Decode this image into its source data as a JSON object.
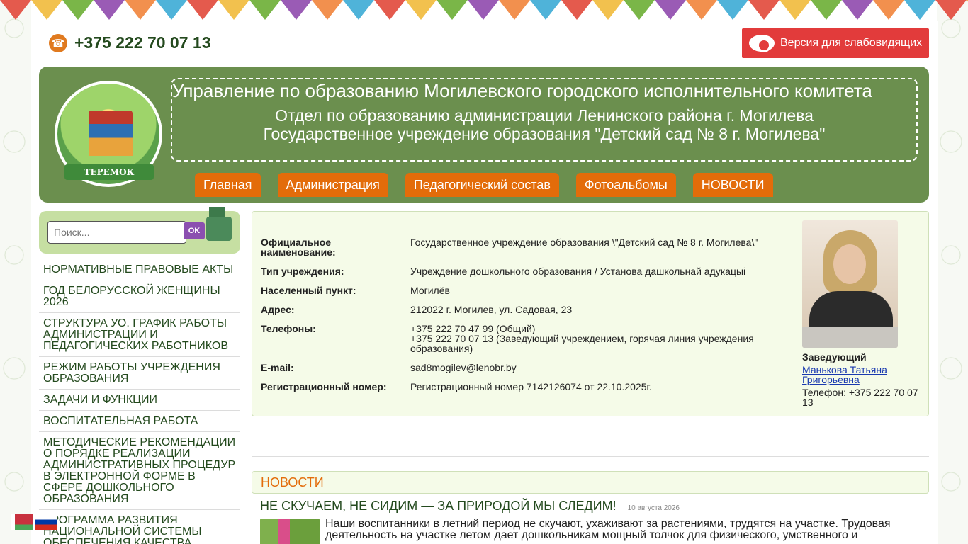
{
  "colors": {
    "header_green": "#6b8f4e",
    "nav_orange": "#e36c0a",
    "vision_red": "#e23b3b",
    "text_dark_green": "#244a1e",
    "panel_bg": "#f5fbe8"
  },
  "bunting_colors": [
    "#e45a4d",
    "#f2c14e",
    "#7ab648",
    "#9a5bb5",
    "#f2904e",
    "#4fb3d9"
  ],
  "top_bar": {
    "phone_icon": "phone-icon",
    "phone": "+375 222 70 07 13",
    "vision_icon": "eye-icon",
    "vision_label": "Версия для слабовидящих"
  },
  "header": {
    "logo_text": "ТЕРЕМОК",
    "title_main": "Управление по образованию Могилевского городского исполнительного комитета",
    "title_sub1": "Отдел по образованию администрации Ленинского района г. Могилева",
    "title_sub2": "Государственное учреждение образования \"Детский сад № 8 г. Могилева\""
  },
  "nav": [
    {
      "label": "Главная"
    },
    {
      "label": "Администрация"
    },
    {
      "label": "Педагогический состав"
    },
    {
      "label": "Фотоальбомы"
    },
    {
      "label": "НОВОСТИ"
    }
  ],
  "search": {
    "placeholder": "Поиск...",
    "button_label": "OK"
  },
  "sidebar": {
    "items": [
      {
        "label": "НОРМАТИВНЫЕ ПРАВОВЫЕ АКТЫ"
      },
      {
        "label": "ГОД БЕЛОРУССКОЙ ЖЕНЩИНЫ 2026"
      },
      {
        "label": "СТРУКТУРА УО. ГРАФИК РАБОТЫ АДМИНИСТРАЦИИ И ПЕДАГОГИЧЕСКИХ РАБОТНИКОВ"
      },
      {
        "label": "РЕЖИМ РАБОТЫ УЧРЕЖДЕНИЯ ОБРАЗОВАНИЯ"
      },
      {
        "label": "ЗАДАЧИ И ФУНКЦИИ"
      },
      {
        "label": "ВОСПИТАТЕЛЬНАЯ РАБОТА"
      },
      {
        "label": "МЕТОДИЧЕСКИЕ РЕКОМЕНДАЦИИ О ПОРЯДКЕ РЕАЛИЗАЦИИ АДМИНИСТРАТИВНЫХ ПРОЦЕДУР В ЭЛЕКТРОННОЙ ФОРМЕ В СФЕРЕ ДОШКОЛЬНОГО ОБРАЗОВАНИЯ"
      },
      {
        "label": "ПРОГРАММА РАЗВИТИЯ НАЦИОНАЛЬНОЙ СИСТЕМЫ ОБЕСПЕЧЕНИЯ КАЧЕСТВА"
      }
    ]
  },
  "info": {
    "rows": [
      {
        "label": "Официальное наименование:",
        "value": "Государственное учреждение образования \\\"Детский сад № 8 г. Могилева\\\""
      },
      {
        "label": "Тип учреждения:",
        "value": "Учреждение дошкольного образования / Установа дашкольнай адукацыі"
      },
      {
        "label": "Населенный пункт:",
        "value": "Могилёв"
      },
      {
        "label": "Адрес:",
        "value": "212022 г. Могилев, ул. Садовая, 23"
      },
      {
        "label": "Телефоны:",
        "value": "+375 222 70 47 99 (Общий)\n+375 222 70 07 13 (Заведующий учреждением, горячая линия учреждения образования)"
      },
      {
        "label": "E-mail:",
        "value": "sad8mogilev@lenobr.by"
      },
      {
        "label": "Регистрационный номер:",
        "value": "Регистрационный номер 7142126074 от 22.10.2025г."
      }
    ],
    "director": {
      "role": "Заведующий",
      "name": "Манькова Татьяна Григорьевна",
      "phone": "Телефон: +375 222 70 07 13"
    }
  },
  "news": {
    "header": "НОВОСТИ",
    "items": [
      {
        "title": "НЕ СКУЧАЕМ, НЕ СИДИМ — ЗА ПРИРОДОЙ МЫ СЛЕДИМ!",
        "date": "10 августа 2026",
        "text": "Наши воспитанники в летний период не скучают, ухаживают за растениями, трудятся на участке. Трудовая деятельность на участке летом дает дошкольникам мощный толчок для физического, умственного и"
      }
    ]
  },
  "languages": [
    {
      "code": "be",
      "icon": "belarus-flag-icon"
    },
    {
      "code": "ru",
      "icon": "russia-flag-icon"
    }
  ]
}
